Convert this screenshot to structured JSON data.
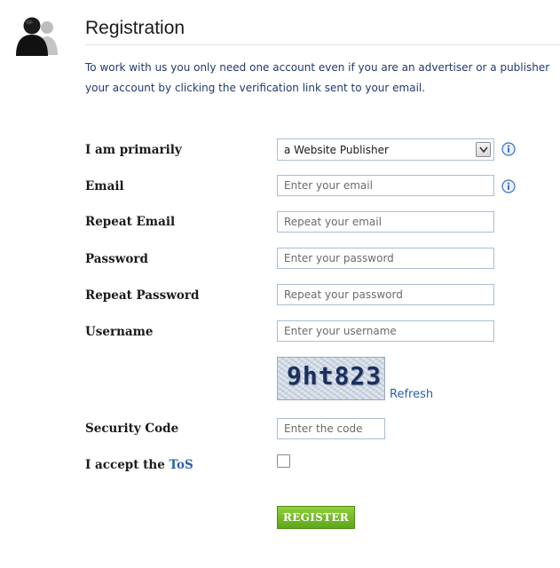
{
  "header": {
    "title": "Registration",
    "intro_line1": "To work with us you only need one account even if you are an advertiser or a publisher",
    "intro_line2": "your account by clicking the verification link sent to your email."
  },
  "form": {
    "account_type": {
      "label": "I am primarily",
      "selected": "a Website Publisher"
    },
    "email": {
      "label": "Email",
      "placeholder": "Enter your email"
    },
    "repeat_email": {
      "label": "Repeat Email",
      "placeholder": "Repeat your email"
    },
    "password": {
      "label": "Password",
      "placeholder": "Enter your password"
    },
    "repeat_password": {
      "label": "Repeat Password",
      "placeholder": "Repeat your password"
    },
    "username": {
      "label": "Username",
      "placeholder": "Enter your username"
    },
    "captcha": {
      "text": "9ht823",
      "refresh_label": "Refresh"
    },
    "security_code": {
      "label": "Security Code",
      "placeholder": "Enter the code"
    },
    "tos": {
      "label_prefix": "I accept the",
      "link_text": "ToS",
      "checked": false
    },
    "submit_label": "REGISTER"
  },
  "icons": {
    "avatar": "user-silhouette-icon",
    "info": "info-icon",
    "dropdown": "chevron-down-icon"
  },
  "colors": {
    "accent_link": "#2a5fa8",
    "intro_text": "#1f3a6e",
    "register_button": "#6fb524",
    "info_icon": "#3f6fc4"
  }
}
